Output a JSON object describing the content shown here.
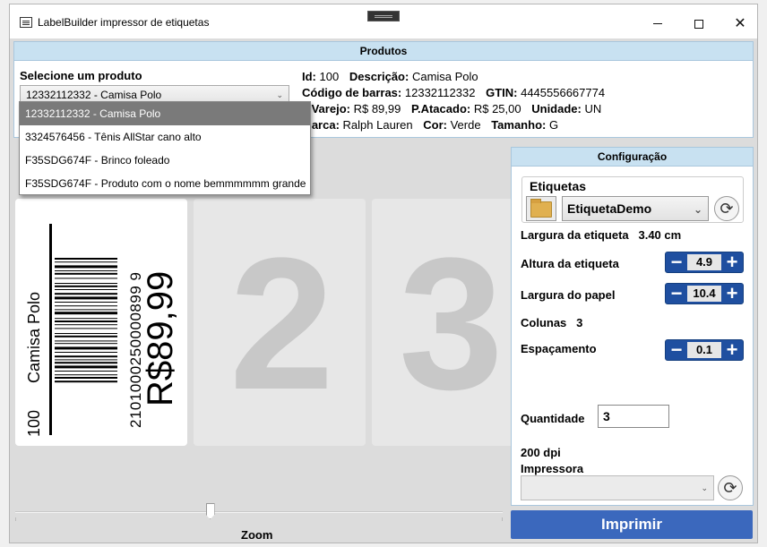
{
  "window": {
    "title": "LabelBuilder impressor de etiquetas"
  },
  "produtos": {
    "header": "Produtos",
    "select_label": "Selecione um produto",
    "selected": "12332112332   -   Camisa Polo",
    "dropdown": [
      {
        "code": "12332112332",
        "name": "Camisa Polo",
        "text": "12332112332  -  Camisa Polo"
      },
      {
        "code": "3324576456",
        "name": "Tênis AllStar cano alto",
        "text": "3324576456  -  Tênis AllStar cano alto"
      },
      {
        "code": "F35SDG674F",
        "name": "Brinco foleado",
        "text": "F35SDG674F  -  Brinco foleado"
      },
      {
        "code": "F35SDG674F",
        "name": "Produto com o nome bemmmmmm grande",
        "text": "F35SDG674F  -  Produto com o nome bemmmmmm grande"
      }
    ],
    "details": {
      "id_label": "Id:",
      "id": "100",
      "descricao_label": "Descrição:",
      "descricao": "Camisa Polo",
      "codigo_label": "Código de barras:",
      "codigo": "12332112332",
      "gtin_label": "GTIN:",
      "gtin": "4445556667774",
      "varejo_label": "P.Varejo:",
      "varejo": "R$ 89,99",
      "atacado_label": "P.Atacado:",
      "atacado": "R$ 25,00",
      "unidade_label": "Unidade:",
      "unidade": "UN",
      "marca_label": "Marca:",
      "marca": "Ralph Lauren",
      "cor_label": "Cor:",
      "cor": "Verde",
      "tamanho_label": "Tamanho:",
      "tamanho": "G"
    }
  },
  "preview": {
    "label1": {
      "name": "Camisa Polo",
      "id": "100",
      "barcode_text": "2101000250000899 9",
      "price": "R$89,99"
    },
    "label2_number": "2",
    "label3_number": "3",
    "zoom_label": "Zoom",
    "zoom_level": 0.4
  },
  "config": {
    "header": "Configuração",
    "etiquetas_title": "Etiquetas",
    "etiqueta_selected": "EtiquetaDemo",
    "largura_etiqueta_label": "Largura da etiqueta",
    "largura_etiqueta_value": "3.40 cm",
    "altura_label": "Altura da etiqueta",
    "altura_value": "4.9",
    "largura_papel_label": "Largura do papel",
    "largura_papel_value": "10.4",
    "colunas_label": "Colunas",
    "colunas_value": "3",
    "espacamento_label": "Espaçamento",
    "espacamento_value": "0.1",
    "quantidade_label": "Quantidade",
    "quantidade_value": "3",
    "dpi": "200 dpi",
    "impressora_label": "Impressora",
    "impressora_value": ""
  },
  "actions": {
    "print": "Imprimir"
  },
  "icons": {
    "minus": "−",
    "plus": "+",
    "refresh": "⟳",
    "chevron": "⌄"
  }
}
